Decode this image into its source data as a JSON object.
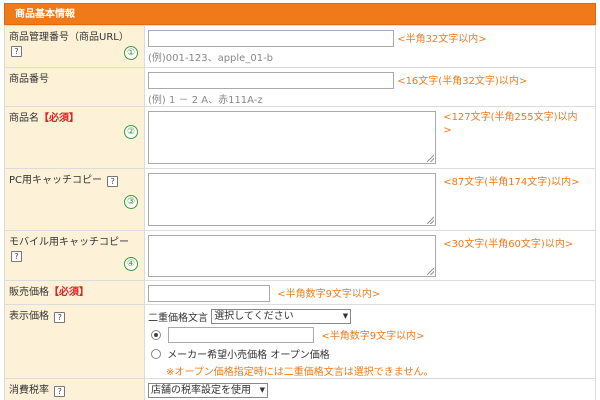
{
  "section": {
    "title": "商品基本情報"
  },
  "rows": {
    "manage_id": {
      "label": "商品管理番号（商品URL）",
      "number": "①",
      "hint": "<半角32文字以内>",
      "example": "(例)001-123、apple_01-b",
      "value": ""
    },
    "item_number": {
      "label": "商品番号",
      "hint": "<16文字(半角32文字)以内>",
      "example": "(例) 1 － 2 A、赤111A-z",
      "value": ""
    },
    "item_name": {
      "label": "商品名",
      "required": "【必須】",
      "number": "②",
      "hint": "<127文字(半角255文字)以内>",
      "value": ""
    },
    "pc_catch": {
      "label": "PC用キャッチコピー",
      "number": "③",
      "hint": "<87文字(半角174文字)以内>",
      "value": ""
    },
    "mobile_catch": {
      "label": "モバイル用キャッチコピー",
      "number": "④",
      "hint": "<30文字(半角60文字)以内>",
      "value": ""
    },
    "price": {
      "label": "販売価格",
      "required": "【必須】",
      "hint": "<半角数字9文字以内>",
      "value": ""
    },
    "display_price": {
      "label": "表示価格",
      "dual_label": "二重価格文言",
      "dual_select": "選択してください",
      "hint": "<半角数字9文字以内>",
      "value": "",
      "option_maker": "メーカー希望小売価格 オープン価格",
      "warning": "※オープン価格指定時には二重価格文言は選択できません。"
    },
    "tax": {
      "label": "消費税率",
      "select": "店舗の税率設定を使用"
    }
  },
  "icons": {
    "help": "?",
    "dropdown": "▼"
  },
  "colors": {
    "header": "#f07a1a",
    "label_bg": "#fdf2d8",
    "hint": "#f07a1a",
    "required": "#e02020",
    "number": "#3a9a3a"
  }
}
